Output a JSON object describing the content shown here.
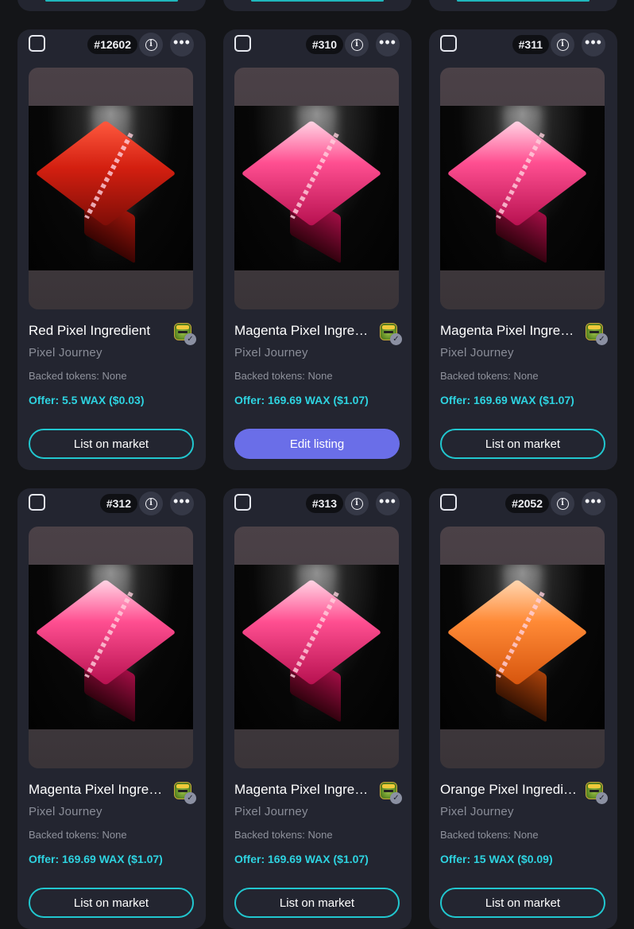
{
  "colors": {
    "background": "#141518",
    "card": "#232530",
    "accent_cyan": "#2ed3e0",
    "button_border": "#21c7cf",
    "edit_button": "#6a6ee8"
  },
  "icons": {
    "checkbox": "checkbox-icon",
    "info": "info-icon",
    "more": "more-horizontal-icon",
    "verified": "verified-check-icon"
  },
  "info_glyph": "i",
  "more_glyph": "•••",
  "verified_glyph": "✓",
  "cards": [
    {
      "id": "#12602",
      "name": "Red Pixel Ingredient",
      "display_name": "Red Pixel Ingredient",
      "collection": "Pixel Journey",
      "backed": "Backed tokens: None",
      "offer": "Offer: 5.5 WAX ($0.03)",
      "action": "List on market",
      "color": "red"
    },
    {
      "id": "#310",
      "name": "Magenta Pixel Ingredient",
      "display_name": "Magenta Pixel Ingredi...",
      "collection": "Pixel Journey",
      "backed": "Backed tokens: None",
      "offer": "Offer: 169.69 WAX ($1.07)",
      "action": "Edit listing",
      "color": "magenta"
    },
    {
      "id": "#311",
      "name": "Magenta Pixel Ingredient",
      "display_name": "Magenta Pixel Ingredi...",
      "collection": "Pixel Journey",
      "backed": "Backed tokens: None",
      "offer": "Offer: 169.69 WAX ($1.07)",
      "action": "List on market",
      "color": "magenta"
    },
    {
      "id": "#312",
      "name": "Magenta Pixel Ingredient",
      "display_name": "Magenta Pixel Ingredi...",
      "collection": "Pixel Journey",
      "backed": "Backed tokens: None",
      "offer": "Offer: 169.69 WAX ($1.07)",
      "action": "List on market",
      "color": "magenta"
    },
    {
      "id": "#313",
      "name": "Magenta Pixel Ingredient",
      "display_name": "Magenta Pixel Ingredi...",
      "collection": "Pixel Journey",
      "backed": "Backed tokens: None",
      "offer": "Offer: 169.69 WAX ($1.07)",
      "action": "List on market",
      "color": "magenta"
    },
    {
      "id": "#2052",
      "name": "Orange Pixel Ingredient",
      "display_name": "Orange Pixel Ingredient",
      "collection": "Pixel Journey",
      "backed": "Backed tokens: None",
      "offer": "Offer: 15 WAX ($0.09)",
      "action": "List on market",
      "color": "orange"
    }
  ]
}
